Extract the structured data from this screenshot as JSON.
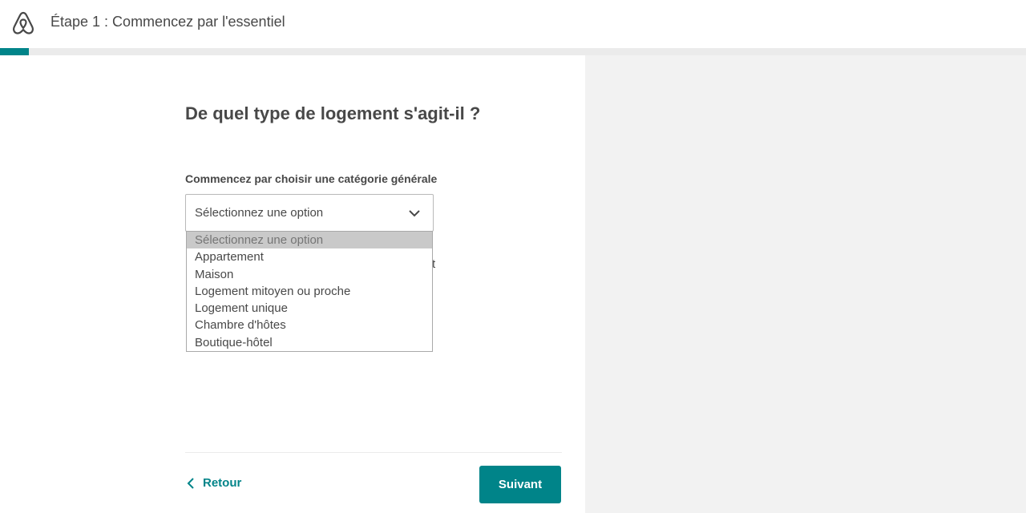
{
  "header": {
    "logo": "airbnb-logo",
    "step_title": "Étape 1 : Commencez par l'essentiel"
  },
  "progress": {
    "fraction": 0.028
  },
  "form": {
    "question": "De quel type de logement s'agit-il ?",
    "field_label": "Commencez par choisir une catégorie générale",
    "select": {
      "value": "Sélectionnez une option",
      "options": [
        "Sélectionnez une option",
        "Appartement",
        "Maison",
        "Logement mitoyen ou proche",
        "Logement unique",
        "Chambre d'hôtes",
        "Boutique-hôtel"
      ]
    },
    "partially_hidden_text": "t"
  },
  "footer": {
    "back_label": "Retour",
    "next_label": "Suivant"
  },
  "colors": {
    "accent": "#008489",
    "text": "#484848",
    "right_pane": "#f2f2f2"
  }
}
